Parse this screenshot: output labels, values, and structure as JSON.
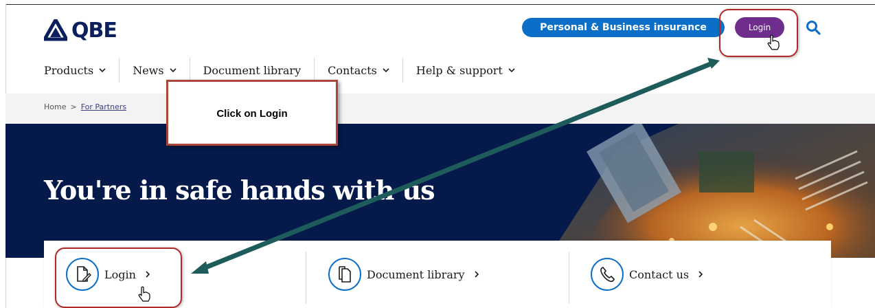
{
  "brand": {
    "name": "QBE",
    "color": "#0a1f5c"
  },
  "header": {
    "personal_business_label": "Personal & Business insurance",
    "login_label": "Login",
    "search_icon": "search-icon"
  },
  "nav": {
    "items": [
      {
        "label": "Products",
        "has_dropdown": true
      },
      {
        "label": "News",
        "has_dropdown": true
      },
      {
        "label": "Document library",
        "has_dropdown": false
      },
      {
        "label": "Contacts",
        "has_dropdown": true
      },
      {
        "label": "Help & support",
        "has_dropdown": true
      }
    ]
  },
  "breadcrumb": {
    "home": "Home",
    "separator": ">",
    "current": "For Partners"
  },
  "hero": {
    "title": "You're in safe hands with us"
  },
  "quick_links": [
    {
      "label": "Login",
      "icon": "document-edit-icon"
    },
    {
      "label": "Document library",
      "icon": "documents-icon"
    },
    {
      "label": "Contact us",
      "icon": "phone-icon"
    }
  ],
  "annotation": {
    "callout_text": "Click on Login"
  },
  "colors": {
    "primary_blue": "#0c6fc7",
    "login_purple": "#6f2d8e",
    "hero_navy": "#051a4a",
    "annotation_red": "#b3262a",
    "arrow_teal": "#1e5b5b"
  }
}
